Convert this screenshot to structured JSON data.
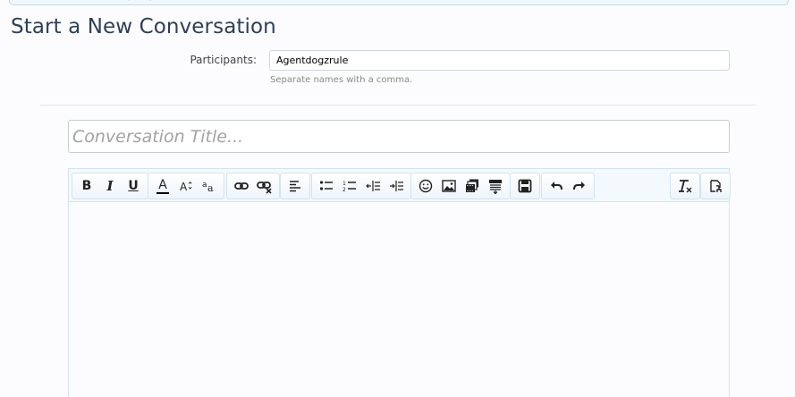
{
  "page": {
    "title": "Start a New Conversation"
  },
  "participants": {
    "label": "Participants:",
    "value": "Agentdogzrule",
    "hint": "Separate names with a comma."
  },
  "conversation_title": {
    "placeholder": "Conversation Title..."
  },
  "toolbar": {
    "groups": [
      [
        "bold-icon",
        "italic-icon",
        "underline-icon"
      ],
      [
        "font-color-icon",
        "font-size-icon",
        "font-family-icon"
      ],
      [
        "link-icon",
        "unlink-icon"
      ],
      [
        "align-left-icon"
      ],
      [
        "bullet-list-icon",
        "numbered-list-icon",
        "outdent-icon",
        "indent-icon"
      ],
      [
        "smiley-icon",
        "image-icon",
        "media-icon",
        "insert-template-icon"
      ],
      [
        "save-draft-icon"
      ],
      [
        "undo-icon",
        "redo-icon"
      ],
      [
        "remove-format-icon"
      ],
      [
        "toggle-bbcode-icon"
      ]
    ],
    "bold_glyph": "B",
    "italic_glyph": "I",
    "underline_glyph": "U",
    "font_color_glyph": "A",
    "colors": {
      "icon": "#222222",
      "accent": "#5b7fa5",
      "font_color_bar": "#000000"
    }
  },
  "colors": {
    "page_bg": "#fcfcff",
    "title": "#2f3f56",
    "border": "#d3e4ef"
  }
}
